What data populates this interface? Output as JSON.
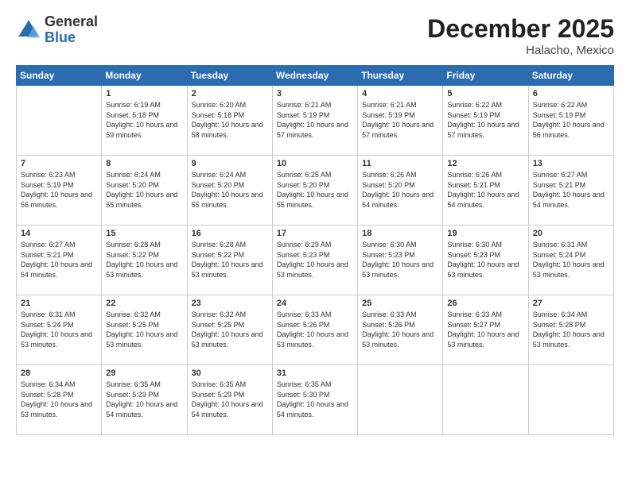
{
  "header": {
    "logo_general": "General",
    "logo_blue": "Blue",
    "month_title": "December 2025",
    "location": "Halacho, Mexico"
  },
  "weekdays": [
    "Sunday",
    "Monday",
    "Tuesday",
    "Wednesday",
    "Thursday",
    "Friday",
    "Saturday"
  ],
  "weeks": [
    [
      {
        "day": "",
        "empty": true
      },
      {
        "day": "1",
        "sunrise": "6:19 AM",
        "sunset": "5:18 PM",
        "daylight": "10 hours and 59 minutes."
      },
      {
        "day": "2",
        "sunrise": "6:20 AM",
        "sunset": "5:18 PM",
        "daylight": "10 hours and 58 minutes."
      },
      {
        "day": "3",
        "sunrise": "6:21 AM",
        "sunset": "5:19 PM",
        "daylight": "10 hours and 57 minutes."
      },
      {
        "day": "4",
        "sunrise": "6:21 AM",
        "sunset": "5:19 PM",
        "daylight": "10 hours and 57 minutes."
      },
      {
        "day": "5",
        "sunrise": "6:22 AM",
        "sunset": "5:19 PM",
        "daylight": "10 hours and 57 minutes."
      },
      {
        "day": "6",
        "sunrise": "6:22 AM",
        "sunset": "5:19 PM",
        "daylight": "10 hours and 56 minutes."
      }
    ],
    [
      {
        "day": "7",
        "sunrise": "6:23 AM",
        "sunset": "5:19 PM",
        "daylight": "10 hours and 56 minutes."
      },
      {
        "day": "8",
        "sunrise": "6:24 AM",
        "sunset": "5:20 PM",
        "daylight": "10 hours and 55 minutes."
      },
      {
        "day": "9",
        "sunrise": "6:24 AM",
        "sunset": "5:20 PM",
        "daylight": "10 hours and 55 minutes."
      },
      {
        "day": "10",
        "sunrise": "6:25 AM",
        "sunset": "5:20 PM",
        "daylight": "10 hours and 55 minutes."
      },
      {
        "day": "11",
        "sunrise": "6:26 AM",
        "sunset": "5:20 PM",
        "daylight": "10 hours and 54 minutes."
      },
      {
        "day": "12",
        "sunrise": "6:26 AM",
        "sunset": "5:21 PM",
        "daylight": "10 hours and 54 minutes."
      },
      {
        "day": "13",
        "sunrise": "6:27 AM",
        "sunset": "5:21 PM",
        "daylight": "10 hours and 54 minutes."
      }
    ],
    [
      {
        "day": "14",
        "sunrise": "6:27 AM",
        "sunset": "5:21 PM",
        "daylight": "10 hours and 54 minutes."
      },
      {
        "day": "15",
        "sunrise": "6:28 AM",
        "sunset": "5:22 PM",
        "daylight": "10 hours and 53 minutes."
      },
      {
        "day": "16",
        "sunrise": "6:28 AM",
        "sunset": "5:22 PM",
        "daylight": "10 hours and 53 minutes."
      },
      {
        "day": "17",
        "sunrise": "6:29 AM",
        "sunset": "5:23 PM",
        "daylight": "10 hours and 53 minutes."
      },
      {
        "day": "18",
        "sunrise": "6:30 AM",
        "sunset": "5:23 PM",
        "daylight": "10 hours and 53 minutes."
      },
      {
        "day": "19",
        "sunrise": "6:30 AM",
        "sunset": "5:23 PM",
        "daylight": "10 hours and 53 minutes."
      },
      {
        "day": "20",
        "sunrise": "6:31 AM",
        "sunset": "5:24 PM",
        "daylight": "10 hours and 53 minutes."
      }
    ],
    [
      {
        "day": "21",
        "sunrise": "6:31 AM",
        "sunset": "5:24 PM",
        "daylight": "10 hours and 53 minutes."
      },
      {
        "day": "22",
        "sunrise": "6:32 AM",
        "sunset": "5:25 PM",
        "daylight": "10 hours and 53 minutes."
      },
      {
        "day": "23",
        "sunrise": "6:32 AM",
        "sunset": "5:25 PM",
        "daylight": "10 hours and 53 minutes."
      },
      {
        "day": "24",
        "sunrise": "6:33 AM",
        "sunset": "5:26 PM",
        "daylight": "10 hours and 53 minutes."
      },
      {
        "day": "25",
        "sunrise": "6:33 AM",
        "sunset": "5:26 PM",
        "daylight": "10 hours and 53 minutes."
      },
      {
        "day": "26",
        "sunrise": "6:33 AM",
        "sunset": "5:27 PM",
        "daylight": "10 hours and 53 minutes."
      },
      {
        "day": "27",
        "sunrise": "6:34 AM",
        "sunset": "5:28 PM",
        "daylight": "10 hours and 53 minutes."
      }
    ],
    [
      {
        "day": "28",
        "sunrise": "6:34 AM",
        "sunset": "5:28 PM",
        "daylight": "10 hours and 53 minutes."
      },
      {
        "day": "29",
        "sunrise": "6:35 AM",
        "sunset": "5:29 PM",
        "daylight": "10 hours and 54 minutes."
      },
      {
        "day": "30",
        "sunrise": "6:35 AM",
        "sunset": "5:29 PM",
        "daylight": "10 hours and 54 minutes."
      },
      {
        "day": "31",
        "sunrise": "6:35 AM",
        "sunset": "5:30 PM",
        "daylight": "10 hours and 54 minutes."
      },
      {
        "day": "",
        "empty": true
      },
      {
        "day": "",
        "empty": true
      },
      {
        "day": "",
        "empty": true
      }
    ]
  ],
  "labels": {
    "sunrise": "Sunrise:",
    "sunset": "Sunset:",
    "daylight": "Daylight:"
  }
}
